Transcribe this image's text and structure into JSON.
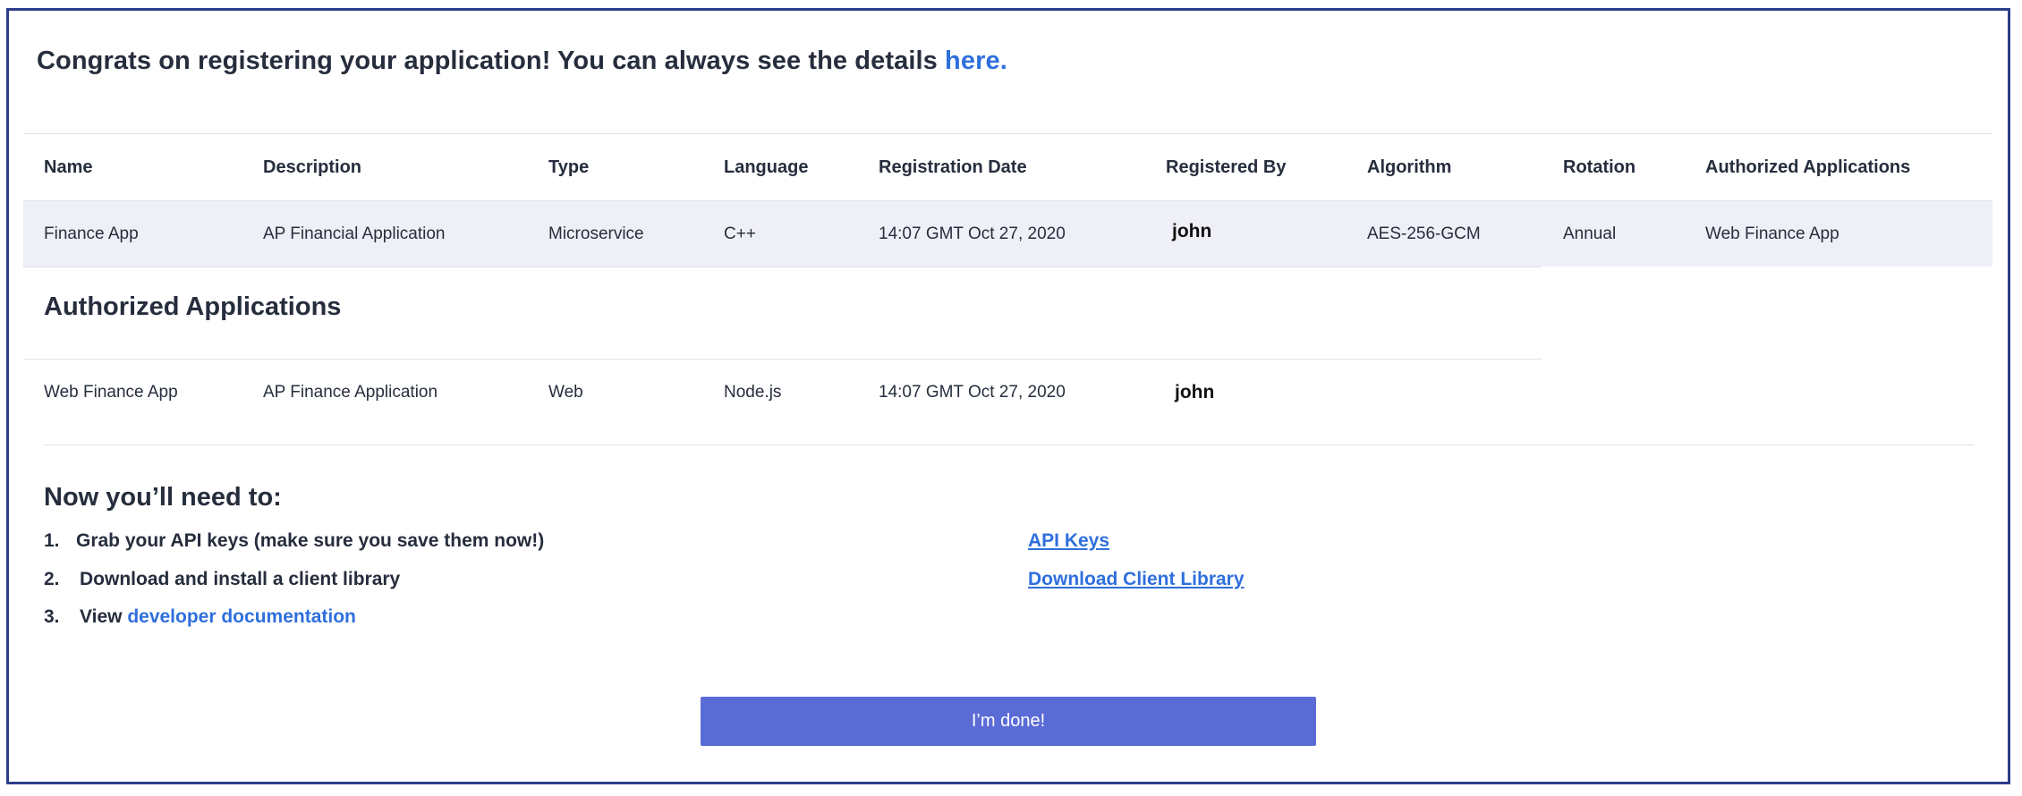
{
  "header": {
    "congrats_text": "Congrats on registering your application! You can always see the details ",
    "details_link": "here."
  },
  "table": {
    "columns": [
      "Name",
      "Description",
      "Type",
      "Language",
      "Registration Date",
      "Registered By",
      "Algorithm",
      "Rotation",
      "Authorized Applications"
    ],
    "rows": [
      [
        "Finance App",
        "AP Financial Application",
        "Microservice",
        "C++",
        "14:07 GMT Oct 27, 2020",
        "john",
        "AES-256-GCM",
        "Annual",
        "Web Finance App"
      ]
    ]
  },
  "authorized": {
    "title": "Authorized Applications",
    "rows": [
      [
        "Web Finance App",
        "AP Finance Application",
        "Web",
        "Node.js",
        "14:07 GMT Oct 27, 2020",
        "john"
      ]
    ]
  },
  "next_steps": {
    "title": "Now you’ll need to:",
    "items": [
      {
        "num": "1.",
        "text": "Grab your API keys (make sure you save them now!)"
      },
      {
        "num": "2.",
        "text": "Download and install a client library"
      },
      {
        "num": "3.",
        "text": "View ",
        "link": "developer documentation"
      }
    ],
    "side_links": [
      "API Keys",
      "Download Client Library"
    ]
  },
  "done_button": "I’m done!",
  "colors": {
    "accent_link": "#2f6fdd",
    "button": "#5b6bd6",
    "frame_border": "#2d3e8a",
    "row_shade": "#eff0f7"
  }
}
